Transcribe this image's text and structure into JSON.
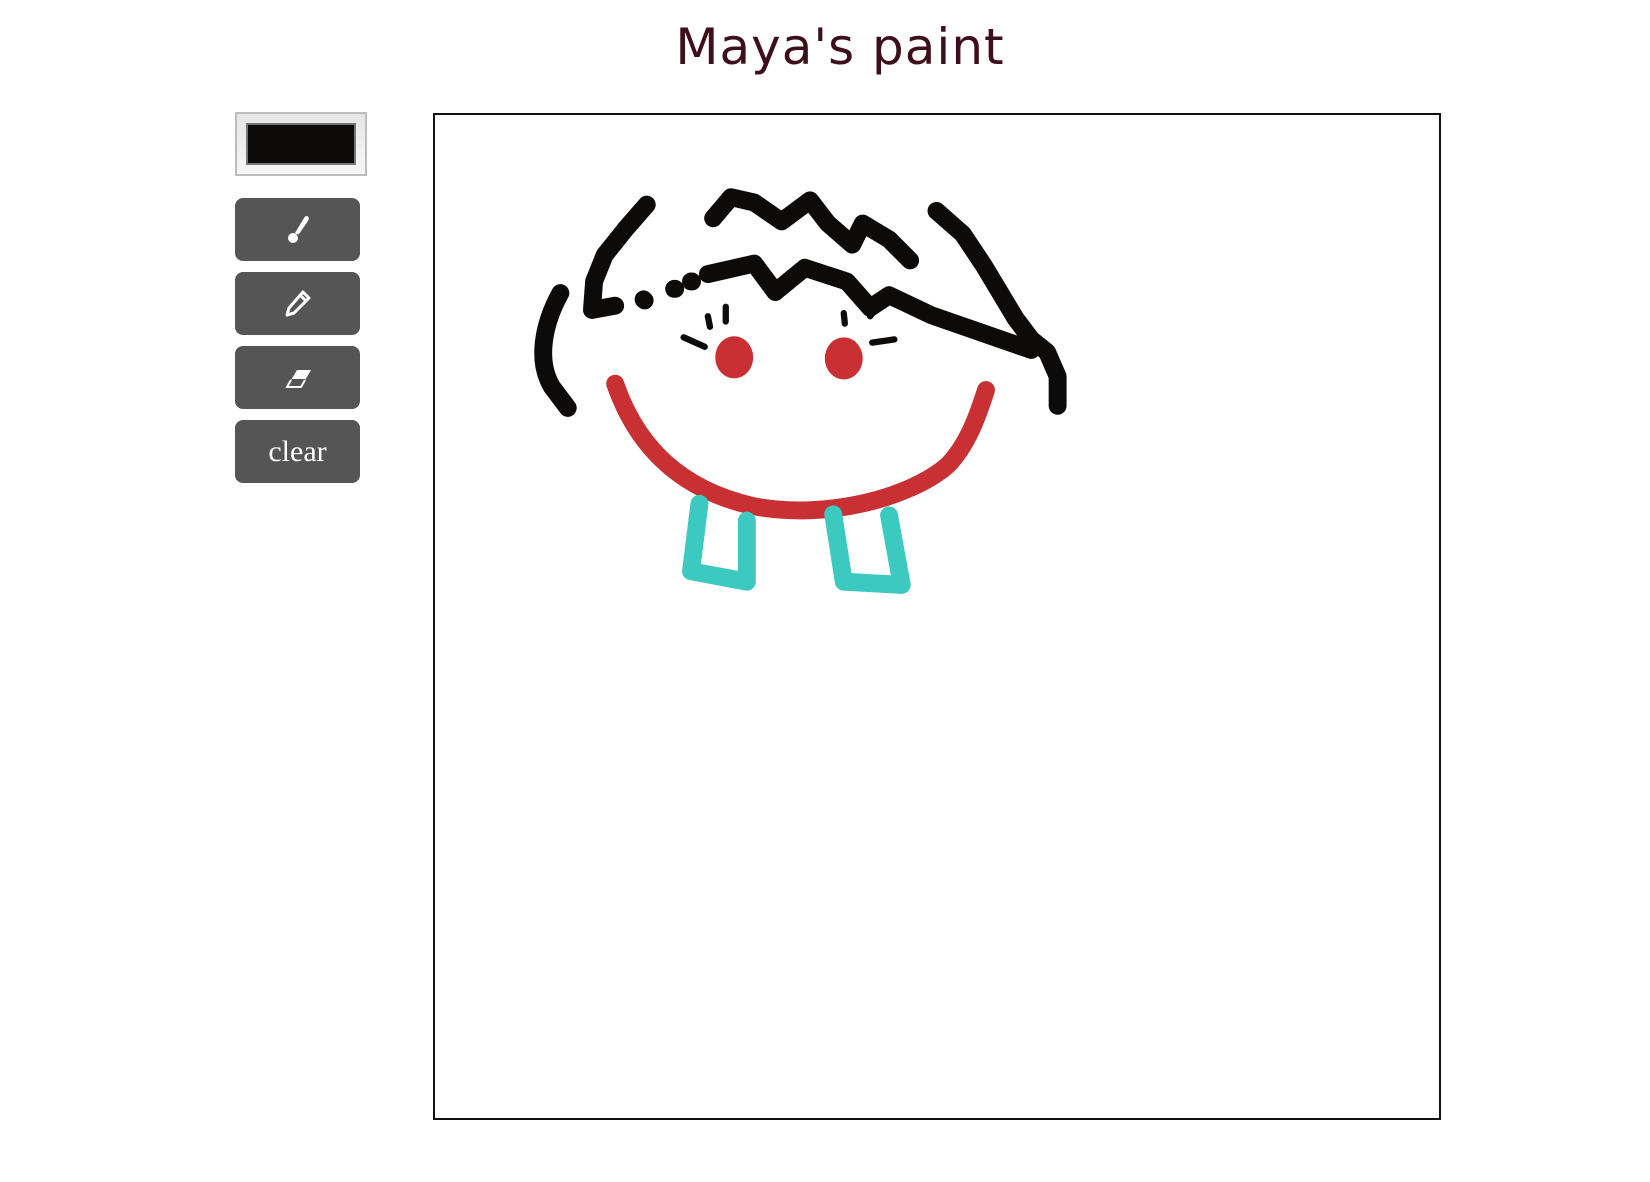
{
  "title": "Maya's paint",
  "toolbar": {
    "current_color": "#0c0b09",
    "tools": [
      {
        "name": "brush",
        "icon": "paintbrush-icon"
      },
      {
        "name": "pencil",
        "icon": "pencil-icon"
      },
      {
        "name": "eraser",
        "icon": "eraser-icon"
      }
    ],
    "clear_label": "clear"
  },
  "canvas": {
    "stroke_colors": {
      "black": "#0c0b09",
      "red": "#c83033",
      "teal": "#3cc9c0"
    }
  }
}
